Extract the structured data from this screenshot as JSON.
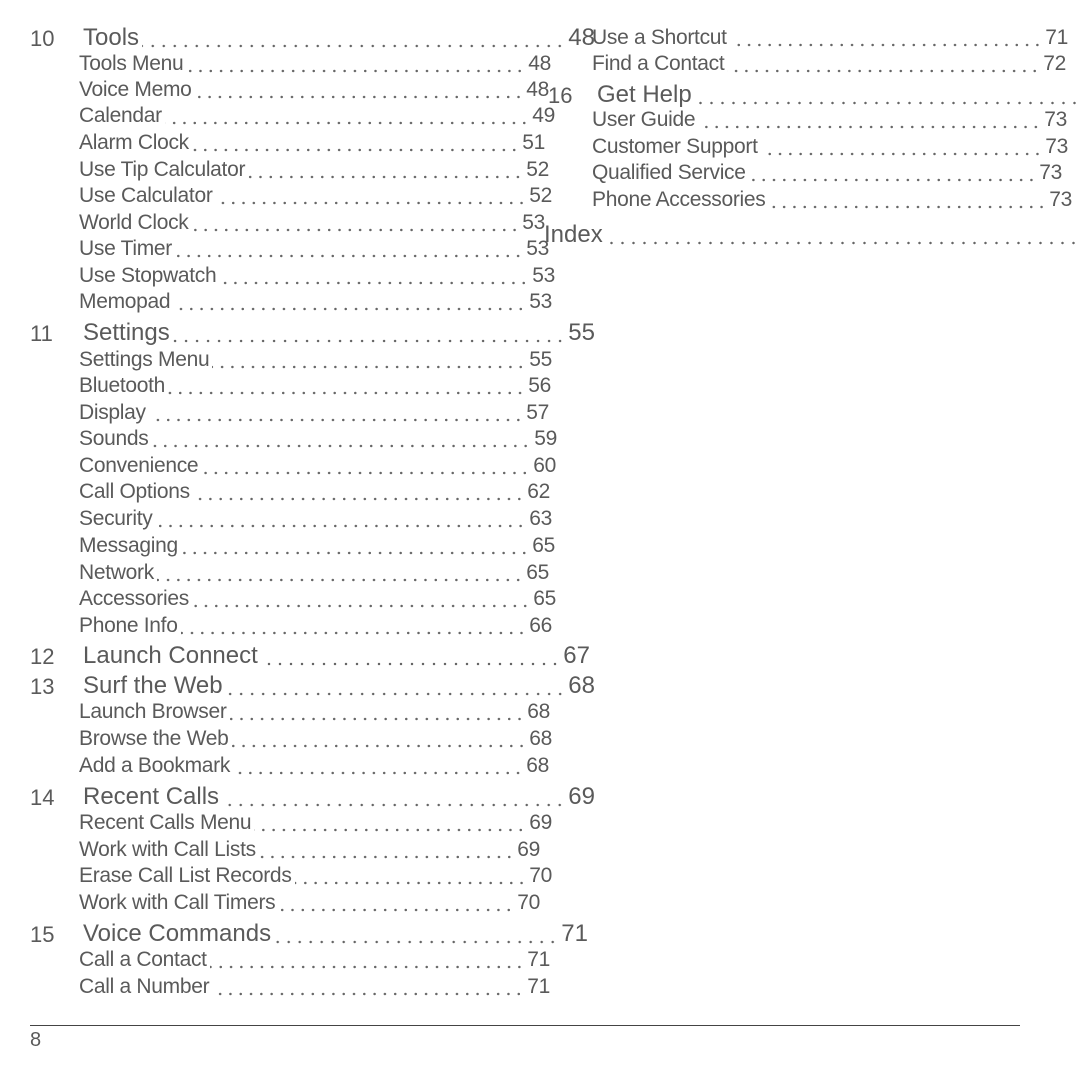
{
  "left": [
    {
      "num": "10",
      "label": "Tools",
      "page": "48",
      "type": "chap"
    },
    {
      "label": "Tools Menu",
      "page": "48",
      "type": "sub"
    },
    {
      "label": "Voice Memo",
      "page": "48",
      "type": "sub"
    },
    {
      "label": "Calendar",
      "page": "49",
      "type": "sub"
    },
    {
      "label": "Alarm Clock",
      "page": "51",
      "type": "sub"
    },
    {
      "label": "Use Tip Calculator",
      "page": "52",
      "type": "sub"
    },
    {
      "label": "Use Calculator",
      "page": "52",
      "type": "sub"
    },
    {
      "label": "World Clock",
      "page": "53",
      "type": "sub"
    },
    {
      "label": "Use Timer",
      "page": "53",
      "type": "sub"
    },
    {
      "label": "Use Stopwatch",
      "page": "53",
      "type": "sub"
    },
    {
      "label": "Memopad",
      "page": "53",
      "type": "sub"
    },
    {
      "num": "11",
      "label": "Settings",
      "page": "55",
      "type": "chap"
    },
    {
      "label": "Settings Menu",
      "page": "55",
      "type": "sub"
    },
    {
      "label": "Bluetooth",
      "page": "56",
      "type": "sub"
    },
    {
      "label": "Display",
      "page": "57",
      "type": "sub"
    },
    {
      "label": "Sounds",
      "page": "59",
      "type": "sub"
    },
    {
      "label": "Convenience",
      "page": "60",
      "type": "sub"
    },
    {
      "label": "Call Options",
      "page": "62",
      "type": "sub"
    },
    {
      "label": "Security",
      "page": "63",
      "type": "sub"
    },
    {
      "label": "Messaging",
      "page": "65",
      "type": "sub"
    },
    {
      "label": "Network",
      "page": "65",
      "type": "sub"
    },
    {
      "label": "Accessories",
      "page": "65",
      "type": "sub"
    },
    {
      "label": "Phone Info",
      "page": "66",
      "type": "sub"
    },
    {
      "num": "12",
      "label": "Launch Connect",
      "page": "67",
      "type": "chap"
    },
    {
      "num": "13",
      "label": "Surf the Web",
      "page": "68",
      "type": "chap"
    },
    {
      "label": "Launch Browser",
      "page": "68",
      "type": "sub"
    },
    {
      "label": "Browse the Web",
      "page": "68",
      "type": "sub"
    },
    {
      "label": "Add a Bookmark",
      "page": "68",
      "type": "sub"
    },
    {
      "num": "14",
      "label": "Recent Calls",
      "page": "69",
      "type": "chap"
    },
    {
      "label": "Recent Calls Menu",
      "page": "69",
      "type": "sub"
    },
    {
      "label": "Work with Call Lists",
      "page": "69",
      "type": "sub"
    },
    {
      "label": "Erase Call List Records",
      "page": "70",
      "type": "sub"
    },
    {
      "label": "Work with Call Timers",
      "page": "70",
      "type": "sub"
    },
    {
      "num": "15",
      "label": "Voice Commands",
      "page": "71",
      "type": "chap"
    },
    {
      "label": "Call a Contact",
      "page": "71",
      "type": "sub"
    },
    {
      "label": "Call a Number",
      "page": "71",
      "type": "sub"
    }
  ],
  "right": [
    {
      "label": "Use a Shortcut",
      "page": "71",
      "type": "sub"
    },
    {
      "label": "Find a Contact",
      "page": "72",
      "type": "sub"
    },
    {
      "num": "16",
      "label": "Get Help",
      "page": "",
      "type": "chap"
    },
    {
      "label": "User Guide",
      "page": "73",
      "type": "sub"
    },
    {
      "label": "Customer Support",
      "page": "73",
      "type": "sub"
    },
    {
      "label": "Qualified Service",
      "page": "73",
      "type": "sub"
    },
    {
      "label": "Phone Accessories",
      "page": "73",
      "type": "sub"
    },
    {
      "label": "Index",
      "page": "",
      "type": "chap"
    }
  ],
  "footer": {
    "page_number": "8"
  }
}
